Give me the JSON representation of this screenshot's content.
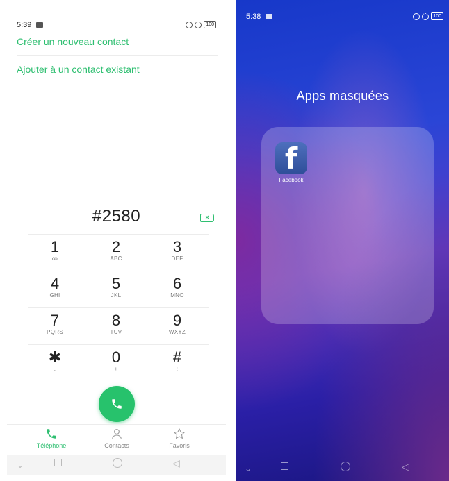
{
  "left_phone": {
    "status": {
      "time": "5:39",
      "battery": "100"
    },
    "menu": [
      {
        "label": "Créer un nouveau contact"
      },
      {
        "label": "Ajouter à un contact existant"
      }
    ],
    "dialer": {
      "number": "#2580",
      "keys": [
        {
          "digit": "1",
          "letters": "ꝏ"
        },
        {
          "digit": "2",
          "letters": "ABC"
        },
        {
          "digit": "3",
          "letters": "DEF"
        },
        {
          "digit": "4",
          "letters": "GHI"
        },
        {
          "digit": "5",
          "letters": "JKL"
        },
        {
          "digit": "6",
          "letters": "MNO"
        },
        {
          "digit": "7",
          "letters": "PQRS"
        },
        {
          "digit": "8",
          "letters": "TUV"
        },
        {
          "digit": "9",
          "letters": "WXYZ"
        },
        {
          "digit": "✱",
          "letters": ","
        },
        {
          "digit": "0",
          "letters": "+"
        },
        {
          "digit": "#",
          "letters": ";"
        }
      ]
    },
    "tabs": [
      {
        "label": "Téléphone",
        "icon": "phone-icon",
        "active": true
      },
      {
        "label": "Contacts",
        "icon": "person-icon",
        "active": false
      },
      {
        "label": "Favoris",
        "icon": "star-icon",
        "active": false
      }
    ],
    "accent_color": "#2fbf71"
  },
  "right_phone": {
    "status": {
      "time": "5:38",
      "battery": "100"
    },
    "title": "Apps masquées",
    "apps": [
      {
        "label": "Facebook",
        "icon": "facebook-icon",
        "glyph": "f"
      }
    ]
  }
}
